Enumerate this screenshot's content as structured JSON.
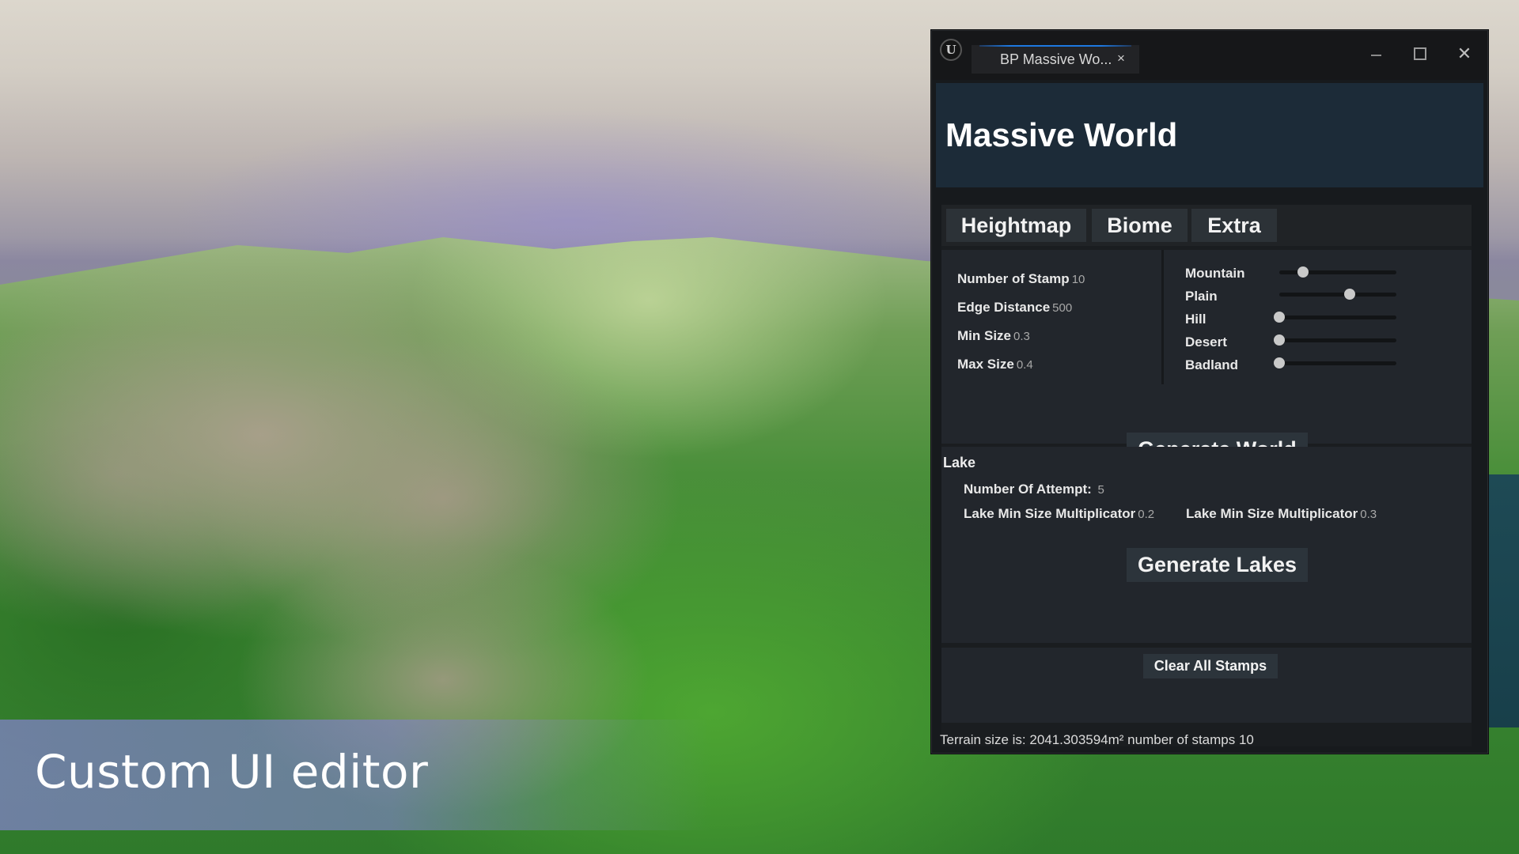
{
  "caption": "Custom UI editor",
  "window": {
    "app_icon": "unreal-engine-logo-icon",
    "tab_title": "BP Massive Wo...",
    "tab_close": "×",
    "controls": {
      "minimize": "minimize-icon",
      "maximize": "maximize-icon",
      "close": "✕"
    }
  },
  "header": {
    "title": "Massive World"
  },
  "tabs": [
    {
      "label": "Heightmap",
      "active": true
    },
    {
      "label": "Biome",
      "active": false
    },
    {
      "label": "Extra",
      "active": false
    }
  ],
  "heightmap": {
    "fields": [
      {
        "label": "Number of Stamp",
        "value": "10"
      },
      {
        "label": "Edge Distance",
        "value": "500"
      },
      {
        "label": "Min Size",
        "value": "0.3"
      },
      {
        "label": "Max Size",
        "value": "0.4"
      }
    ],
    "biomes": [
      {
        "label": "Mountain",
        "value": 0.2
      },
      {
        "label": "Plain",
        "value": 0.6
      },
      {
        "label": "Hill",
        "value": 0.0
      },
      {
        "label": "Desert",
        "value": 0.0
      },
      {
        "label": "Badland",
        "value": 0.0
      }
    ],
    "generate_button": "Generate World"
  },
  "lake": {
    "title": "Lake",
    "attempt_label": "Number Of Attempt:",
    "attempt_value": "5",
    "min_mult_label": "Lake Min Size Multiplicator",
    "min_mult_value": "0.2",
    "max_mult_label": "Lake Min Size Multiplicator",
    "max_mult_value": "0.3",
    "generate_button": "Generate Lakes"
  },
  "clear_button": "Clear All Stamps",
  "status": {
    "text": "Terrain size is: 2041.303594m² number of stamps  10"
  }
}
